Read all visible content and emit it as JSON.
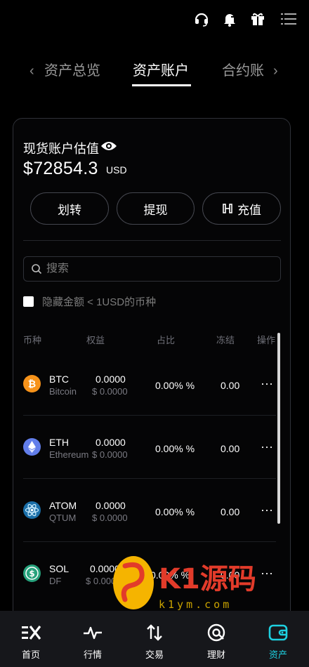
{
  "header": {
    "icons": [
      "headset-icon",
      "bell-icon",
      "gift-icon",
      "menu-icon"
    ]
  },
  "tabs": {
    "items": [
      {
        "label": "资产总览",
        "active": false
      },
      {
        "label": "资产账户",
        "active": true
      },
      {
        "label": "合约账",
        "active": false
      }
    ]
  },
  "account": {
    "title": "现货账户估值",
    "amount": "$72854.3",
    "currency": "USD"
  },
  "actions": {
    "transfer": "划转",
    "withdraw": "提现",
    "deposit": "充值"
  },
  "search": {
    "placeholder": "搜索"
  },
  "filter": {
    "hide_small": "隐藏金额 < 1USD的币种"
  },
  "table": {
    "headers": {
      "coin": "币种",
      "equity": "权益",
      "ratio": "占比",
      "frozen": "冻结",
      "action": "操作"
    },
    "rows": [
      {
        "symbol": "BTC",
        "name": "Bitcoin",
        "equity": "0.0000",
        "equity_usd": "$ 0.0000",
        "ratio": "0.00% %",
        "frozen": "0.00",
        "more": "···",
        "icon": "bitcoin-icon",
        "color": "#f7931a"
      },
      {
        "symbol": "ETH",
        "name": "Ethereum",
        "equity": "0.0000",
        "equity_usd": "$ 0.0000",
        "ratio": "0.00% %",
        "frozen": "0.00",
        "more": "···",
        "icon": "ethereum-icon",
        "color": "#627eea"
      },
      {
        "symbol": "ATOM",
        "name": "QTUM",
        "equity": "0.0000",
        "equity_usd": "$ 0.0000",
        "ratio": "0.00% %",
        "frozen": "0.00",
        "more": "···",
        "icon": "atom-icon",
        "color": "#2e3148"
      },
      {
        "symbol": "SOL",
        "name": "DF",
        "equity": "0.0000",
        "equity_usd": "$ 0.0000",
        "ratio": "0.00% %",
        "frozen": "0.00",
        "more": "···",
        "icon": "dollar-coin-icon",
        "color": "#26a17b"
      }
    ]
  },
  "nav": {
    "items": [
      {
        "label": "首页",
        "icon": "home-logo-icon",
        "active": false
      },
      {
        "label": "行情",
        "icon": "market-pulse-icon",
        "active": false
      },
      {
        "label": "交易",
        "icon": "trade-arrows-icon",
        "active": false
      },
      {
        "label": "理财",
        "icon": "finance-icon",
        "active": false
      },
      {
        "label": "资产",
        "icon": "wallet-icon",
        "active": true
      }
    ]
  },
  "watermark": {
    "brand": "K1源码",
    "domain": "k1ym.com"
  },
  "colors": {
    "accent": "#1ed0e0",
    "background": "#000000",
    "card_border": "#2f3138",
    "muted_text": "#7a7a82"
  }
}
